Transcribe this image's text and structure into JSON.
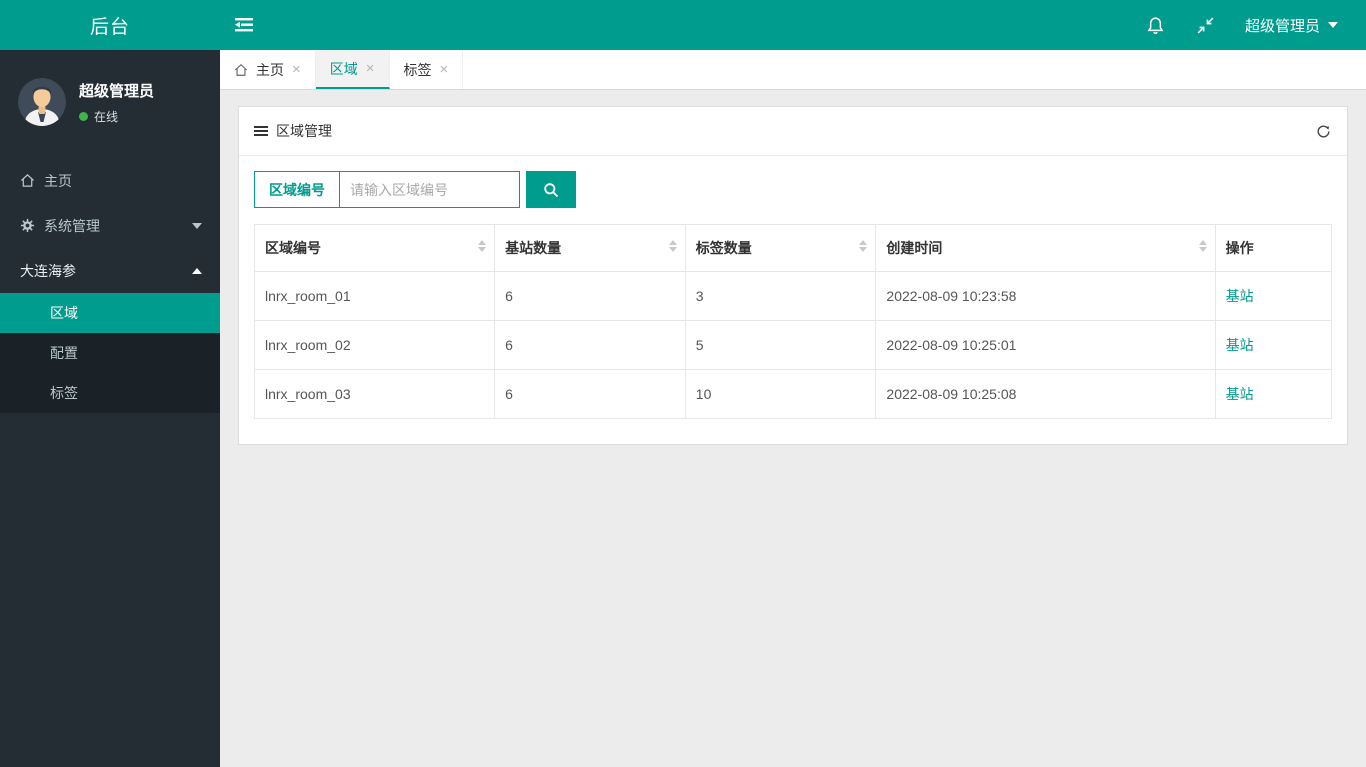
{
  "brand": {
    "logo": "后台"
  },
  "header": {
    "user_menu": "超级管理员",
    "icons": {
      "toggle": "sidebar-toggle-icon",
      "bell": "bell-icon",
      "compress": "fullscreen-compress-icon",
      "caret": "caret-down-icon"
    }
  },
  "sidebar": {
    "user": {
      "name": "超级管理员",
      "status": "在线"
    },
    "menu": [
      {
        "label": "主页",
        "icon": "home-icon"
      },
      {
        "label": "系统管理",
        "icon": "gear-icon",
        "caret": "down"
      },
      {
        "label": "大连海参",
        "caret": "up"
      }
    ],
    "submenu": [
      {
        "label": "区域",
        "active": true
      },
      {
        "label": "配置",
        "active": false
      },
      {
        "label": "标签",
        "active": false
      }
    ]
  },
  "tabs": [
    {
      "label": "主页",
      "icon": "home-icon",
      "close": "×",
      "active": false
    },
    {
      "label": "区域",
      "close": "×",
      "active": true
    },
    {
      "label": "标签",
      "close": "×",
      "active": false
    }
  ],
  "panel": {
    "title": "区域管理",
    "search": {
      "field_label": "区域编号",
      "placeholder": "请输入区域编号"
    },
    "table": {
      "columns": [
        {
          "label": "区域编号",
          "sortable": true
        },
        {
          "label": "基站数量",
          "sortable": true
        },
        {
          "label": "标签数量",
          "sortable": true
        },
        {
          "label": "创建时间",
          "sortable": true
        },
        {
          "label": "操作",
          "sortable": false
        }
      ],
      "rows": [
        [
          "lnrx_room_01",
          "6",
          "3",
          "2022-08-09 10:23:58",
          "基站"
        ],
        [
          "lnrx_room_02",
          "6",
          "5",
          "2022-08-09 10:25:01",
          "基站"
        ],
        [
          "lnrx_room_03",
          "6",
          "10",
          "2022-08-09 10:25:08",
          "基站"
        ]
      ]
    }
  },
  "colors": {
    "accent": "#009c8d",
    "sidebar_bg": "#242d34",
    "submenu_bg": "#1a2127",
    "sidebar_text": "#b8c7ce",
    "page_bg": "#ececec",
    "status_green": "#3db549"
  }
}
